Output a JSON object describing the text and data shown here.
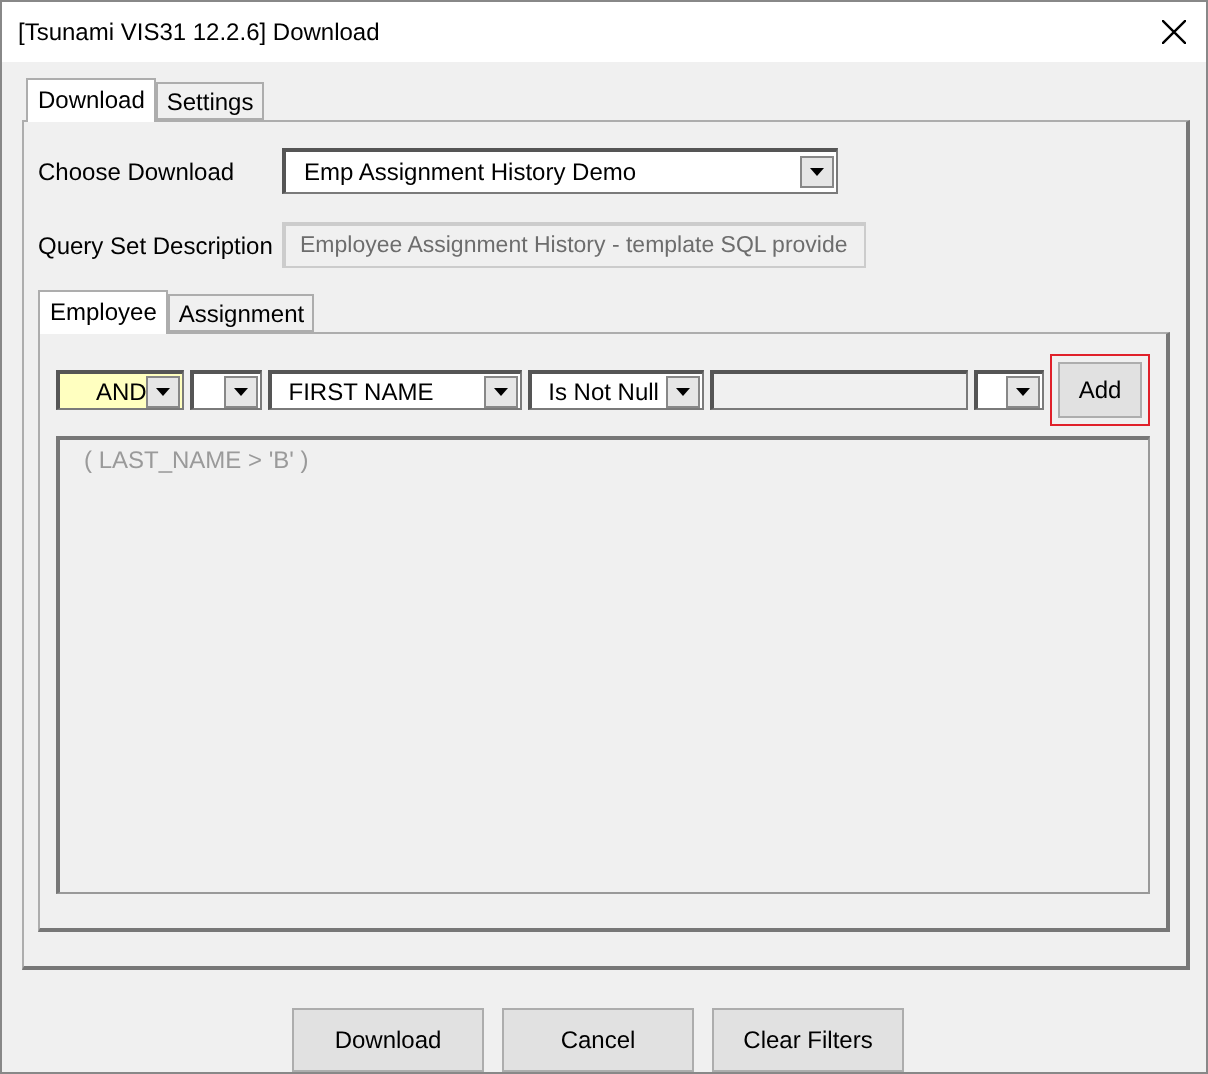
{
  "window": {
    "title": "[Tsunami VIS31 12.2.6] Download"
  },
  "tabs": [
    {
      "label": "Download",
      "selected": true
    },
    {
      "label": "Settings",
      "selected": false
    }
  ],
  "form": [
    {
      "label": "Choose Download",
      "kind": "combo",
      "value": "Emp Assignment History Demo",
      "disabled": false
    },
    {
      "label": "Query Set Description",
      "kind": "field",
      "value": "Employee Assignment History - template SQL provide",
      "disabled": true
    }
  ],
  "sub_tabs": [
    {
      "label": "Employee",
      "selected": true
    },
    {
      "label": "Assignment",
      "selected": false
    }
  ],
  "filter_row": [
    {
      "kind": "combo",
      "value": "AND",
      "highlighted": true
    },
    {
      "kind": "combo",
      "highlighted": false
    },
    {
      "kind": "combo",
      "value": "FIRST NAME",
      "highlighted": false
    },
    {
      "kind": "combo",
      "value": "Is Not Null",
      "highlighted": false
    },
    {
      "kind": "field",
      "disabled": true
    },
    {
      "kind": "combo",
      "highlighted": false
    },
    {
      "kind": "button",
      "label": "Add",
      "highlighted": true
    }
  ],
  "filter_text": "( LAST_NAME > 'B' )",
  "buttons": [
    "Download",
    "Cancel",
    "Clear Filters"
  ]
}
